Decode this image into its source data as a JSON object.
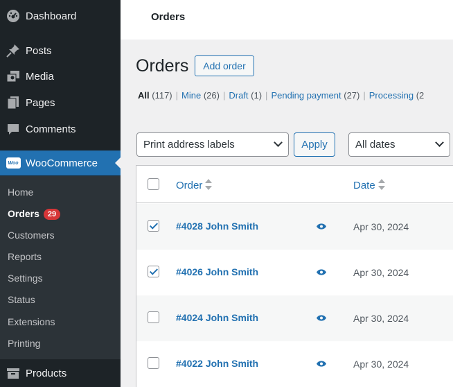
{
  "sidebar": {
    "items": [
      {
        "label": "Dashboard",
        "icon": "dashboard-icon"
      },
      {
        "label": "Posts",
        "icon": "pin-icon"
      },
      {
        "label": "Media",
        "icon": "media-icon"
      },
      {
        "label": "Pages",
        "icon": "pages-icon"
      },
      {
        "label": "Comments",
        "icon": "comment-icon"
      },
      {
        "label": "WooCommerce",
        "icon": "woocommerce-icon",
        "logo_text": "Woo"
      },
      {
        "label": "Products",
        "icon": "products-icon"
      }
    ],
    "submenu": [
      {
        "label": "Home"
      },
      {
        "label": "Orders",
        "badge": "29"
      },
      {
        "label": "Customers"
      },
      {
        "label": "Reports"
      },
      {
        "label": "Settings"
      },
      {
        "label": "Status"
      },
      {
        "label": "Extensions"
      },
      {
        "label": "Printing"
      }
    ]
  },
  "topbar": {
    "title": "Orders"
  },
  "page": {
    "title": "Orders",
    "add_button": "Add order"
  },
  "filters": [
    {
      "label": "All",
      "count": "(117)"
    },
    {
      "label": "Mine",
      "count": "(26)"
    },
    {
      "label": "Draft",
      "count": "(1)"
    },
    {
      "label": "Pending payment",
      "count": "(27)"
    },
    {
      "label": "Processing",
      "count": "(2"
    }
  ],
  "bulk": {
    "selected": "Print address labels",
    "apply": "Apply",
    "dates": "All dates"
  },
  "table": {
    "columns": {
      "order": "Order",
      "date": "Date"
    },
    "rows": [
      {
        "order": "#4028 John Smith",
        "date": "Apr 30, 2024",
        "checked": true
      },
      {
        "order": "#4026 John Smith",
        "date": "Apr 30, 2024",
        "checked": true
      },
      {
        "order": "#4024 John Smith",
        "date": "Apr 30, 2024",
        "checked": false
      },
      {
        "order": "#4022 John Smith",
        "date": "Apr 30, 2024",
        "checked": false
      }
    ]
  },
  "colors": {
    "sidebar": "#1d2327",
    "accent": "#2271b1",
    "badge": "#d63638"
  }
}
